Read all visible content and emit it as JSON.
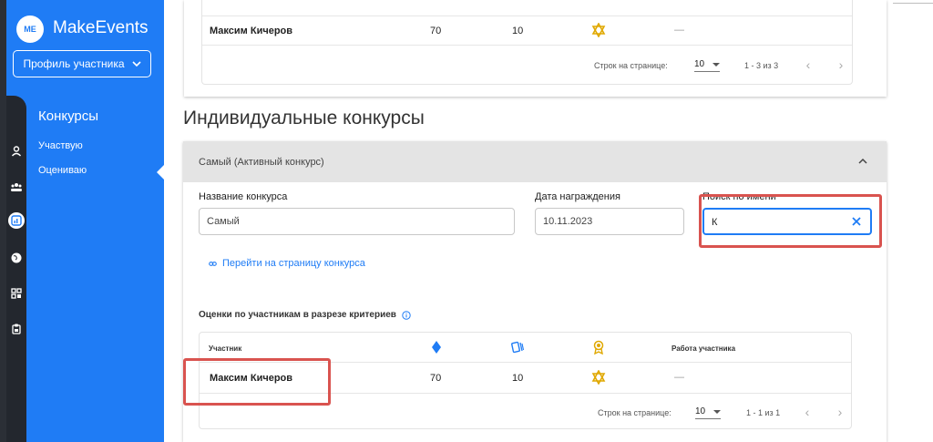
{
  "app": {
    "logo_text": "ME",
    "brand": "MakeEvents"
  },
  "sidebar": {
    "profile_button": "Профиль участника",
    "section_title": "Конкурсы",
    "items": [
      {
        "label": "Участвую"
      },
      {
        "label": "Оцениваю"
      }
    ]
  },
  "top_table": {
    "row": {
      "name": "Максим Кичеров",
      "score1": "70",
      "score2": "10",
      "work": "—"
    },
    "pager": {
      "rows_label": "Строк на странице:",
      "rows_value": "10",
      "range": "1 - 3 из 3"
    }
  },
  "main": {
    "section_title": "Индивидуальные конкурсы",
    "accordion_title": "Самый (Активный конкурс)",
    "fields": {
      "contest_name_label": "Название конкурса",
      "contest_name_value": "Самый",
      "award_date_label": "Дата награждения",
      "award_date_value": "10.11.2023",
      "search_label": "Поиск по имени",
      "search_value": "К"
    },
    "link": "Перейти на страницу конкурса",
    "scores_title": "Оценки по участникам в разрезе критериев",
    "table": {
      "col_participant": "Участник",
      "col_work": "Работа участника",
      "row": {
        "name": "Максим Кичеров",
        "score1": "70",
        "score2": "10",
        "work": "—"
      },
      "pager": {
        "rows_label": "Строк на странице:",
        "rows_value": "10",
        "range": "1 - 1 из 1"
      }
    }
  },
  "colors": {
    "accent": "#1f7cf5",
    "highlight": "#d9534f",
    "star": "#e0a800"
  }
}
